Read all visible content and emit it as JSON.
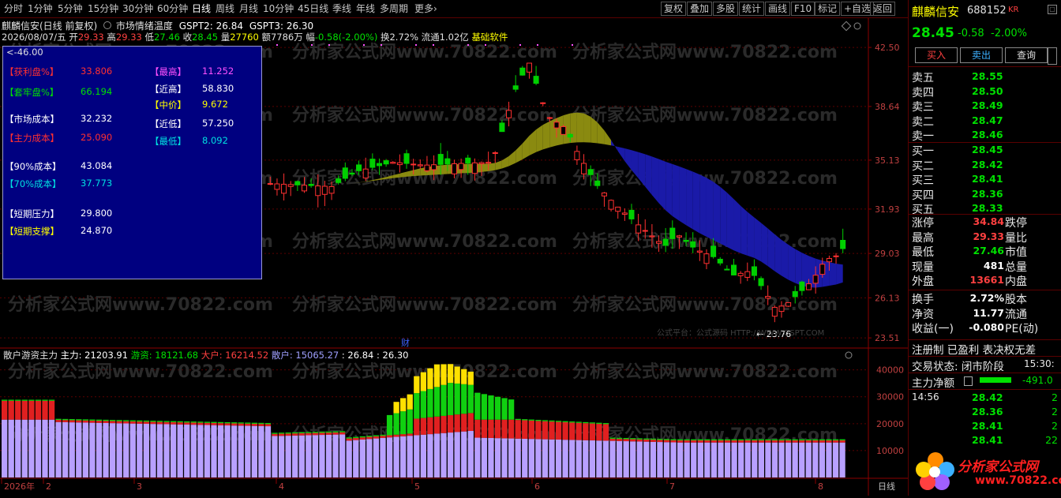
{
  "toolbar": {
    "periods": [
      "分时",
      "1分钟",
      "5分钟",
      "15分钟",
      "30分钟",
      "60分钟",
      "日线",
      "周线",
      "月线",
      "10分钟",
      "45日线",
      "季线",
      "年线",
      "多周期",
      "更多"
    ],
    "active_period": "日线",
    "tools": [
      "复权",
      "叠加",
      "多股",
      "统计",
      "画线",
      "F10",
      "标记",
      "+自选",
      "返回"
    ]
  },
  "header": {
    "title": "麒麟信安(日线 前复权)",
    "indicator": "市场情绪温度",
    "gspt2_label": "GSPT2: 26.84",
    "gspt3_label": "GSPT3: 26.30",
    "ohlc_line": {
      "date": "2026/08/07/五",
      "open_label": "开",
      "open": "29.33",
      "high_label": "高",
      "high": "29.33",
      "low_label": "低",
      "low": "27.46",
      "close_label": "收",
      "close": "28.45",
      "vol_label": "量",
      "vol": "27760",
      "amt_label": "额",
      "amt": "7786万",
      "chg_label": "幅",
      "chg": "-0.58(-2.00%)",
      "turn": "换2.72%",
      "float": "流通1.02亿",
      "software": "基础软件"
    }
  },
  "info_panel": {
    "top_value": "46.00",
    "left_rows": [
      {
        "label": "【获利盘%】",
        "value": "33.806",
        "color": "#ff3030",
        "vcolor": "#ff3030"
      },
      {
        "label": "【套牢盘%】",
        "value": "66.194",
        "color": "#00e000",
        "vcolor": "#00e000"
      },
      {
        "label": "【市场成本】",
        "value": "32.232",
        "color": "#ffffff",
        "vcolor": "#ffffff"
      },
      {
        "label": "【主力成本】",
        "value": "25.090",
        "color": "#ff3030",
        "vcolor": "#ff3030"
      },
      {
        "label": "【90%成本】",
        "value": "43.084",
        "color": "#ffffff",
        "vcolor": "#ffffff"
      },
      {
        "label": "【70%成本】",
        "value": "37.773",
        "color": "#00e0e0",
        "vcolor": "#00e0e0"
      },
      {
        "label": "【短期压力】",
        "value": "29.800",
        "color": "#ffffff",
        "vcolor": "#ffffff"
      },
      {
        "label": "【短期支撑】",
        "value": "24.870",
        "color": "#ffff00",
        "vcolor": "#ffffff"
      }
    ],
    "right_rows": [
      {
        "label": "【最高】",
        "value": "11.252",
        "color": "#ff50ff",
        "vcolor": "#ff50ff"
      },
      {
        "label": "【近高】",
        "value": "58.830",
        "color": "#ffffff",
        "vcolor": "#ffffff"
      },
      {
        "label": "【中价】",
        "value": "9.672",
        "color": "#ffff00",
        "vcolor": "#ffff00"
      },
      {
        "label": "【近低】",
        "value": "57.250",
        "color": "#ffffff",
        "vcolor": "#ffffff"
      },
      {
        "label": "【最低】",
        "value": "8.092",
        "color": "#00e0e0",
        "vcolor": "#00e0e0"
      }
    ]
  },
  "price_axis": [
    "42.50",
    "38.64",
    "35.13",
    "31.93",
    "29.03",
    "26.13",
    "23.51"
  ],
  "volume_axis": [
    "40000",
    "30000",
    "20000",
    "10000"
  ],
  "low_marker": "23.76",
  "watermark": "分析家公式网www.70822.com",
  "credit": "公式平台：公式源码 HTTP://WWW.GSPT.COM",
  "fin_marker": "财",
  "sub_indicator": {
    "name": "散户游资主力",
    "zhuli": "主力: 21203.91",
    "youzi": "游资: 18121.68",
    "dahu": "大户: 16214.52",
    "sanhu": "散户: 15065.27",
    "v1": ": 26.84",
    "v2": ": 26.30"
  },
  "x_axis": [
    "2026年",
    "2",
    "3",
    "4",
    "5",
    "6",
    "7",
    "8"
  ],
  "x_axis_right": "日线",
  "chart_data": {
    "type": "candlestick",
    "price_range": [
      23.0,
      44.0
    ],
    "volume_range": [
      0,
      44000
    ],
    "series_count": 85
  },
  "quote": {
    "name": "麒麟信安",
    "code": "688152",
    "badge": "KR",
    "price": "28.45",
    "change": "-0.58",
    "pct": "-2.00%",
    "buttons": [
      "买入",
      "卖出",
      "查询"
    ],
    "asks": [
      {
        "label": "卖五",
        "price": "28.55"
      },
      {
        "label": "卖四",
        "price": "28.50"
      },
      {
        "label": "卖三",
        "price": "28.49"
      },
      {
        "label": "卖二",
        "price": "28.47"
      },
      {
        "label": "卖一",
        "price": "28.46"
      }
    ],
    "bids": [
      {
        "label": "买一",
        "price": "28.45"
      },
      {
        "label": "买二",
        "price": "28.42"
      },
      {
        "label": "买三",
        "price": "28.41"
      },
      {
        "label": "买四",
        "price": "28.36"
      },
      {
        "label": "买五",
        "price": "28.33"
      }
    ],
    "stats": [
      {
        "l1": "涨停",
        "v1": "34.84",
        "c1": "#ff4040",
        "l2": "跌停"
      },
      {
        "l1": "最高",
        "v1": "29.33",
        "c1": "#ff4040",
        "l2": "量比"
      },
      {
        "l1": "最低",
        "v1": "27.46",
        "c1": "#00e000",
        "l2": "市值"
      },
      {
        "l1": "现量",
        "v1": "481",
        "c1": "#ffffff",
        "l2": "总量"
      },
      {
        "l1": "外盘",
        "v1": "13661",
        "c1": "#ff4040",
        "l2": "内盘"
      }
    ],
    "stats2": [
      {
        "l1": "换手",
        "v1": "2.72%",
        "c1": "#ffffff",
        "l2": "股本"
      },
      {
        "l1": "净资",
        "v1": "11.77",
        "c1": "#ffffff",
        "l2": "流通"
      },
      {
        "l1": "收益(一)",
        "v1": "-0.080",
        "c1": "#ffffff",
        "l2": "PE(动)"
      }
    ],
    "reg": "注册制 已盈利 表决权无差",
    "status_label": "交易状态: 闭市阶段",
    "status_time": "15:30:",
    "net_label": "主力净额",
    "net_value": "-491.0",
    "ticks": [
      {
        "time": "14:56",
        "price": "28.42",
        "vol": "2"
      },
      {
        "time": "",
        "price": "28.36",
        "vol": "2"
      },
      {
        "time": "",
        "price": "28.41",
        "vol": "2"
      },
      {
        "time": "",
        "price": "28.41",
        "vol": "22"
      }
    ],
    "logo_text": "分析家公式网",
    "logo_url": "www.70822.com"
  }
}
